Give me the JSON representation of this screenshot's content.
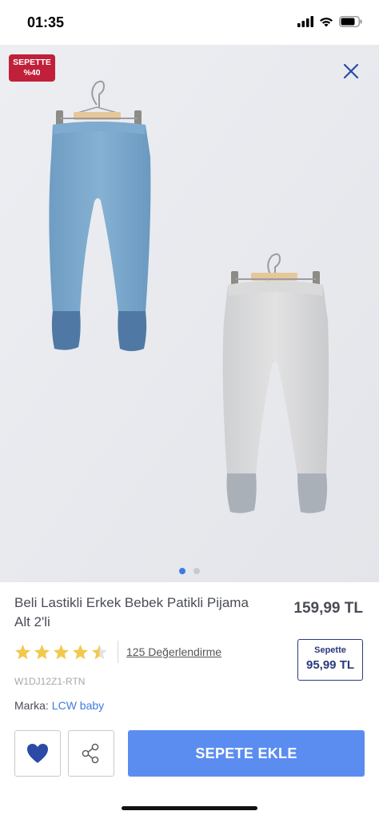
{
  "status_bar": {
    "time": "01:35"
  },
  "badge": {
    "line1": "SEPETTE",
    "line2": "%40"
  },
  "gallery": {
    "pages": 2,
    "active_index": 0
  },
  "product": {
    "title": "Beli Lastikli Erkek Bebek Patikli Pijama Alt 2'li",
    "price": "159,99 TL",
    "cart_price_label": "Sepette",
    "cart_price": "95,99 TL",
    "rating": 4.5,
    "reviews_label": "125 Değerlendirme",
    "sku": "W1DJ12Z1-RTN",
    "brand_label": "Marka:",
    "brand_name": "LCW baby"
  },
  "actions": {
    "add_to_cart": "SEPETE EKLE"
  },
  "colors": {
    "accent": "#5b8df0",
    "badge": "#c0203a",
    "star": "#f2c94c",
    "heart": "#2b4aa8"
  },
  "icons": [
    "signal-icon",
    "wifi-icon",
    "battery-icon",
    "close-icon",
    "heart-icon",
    "share-icon",
    "star-icon"
  ]
}
